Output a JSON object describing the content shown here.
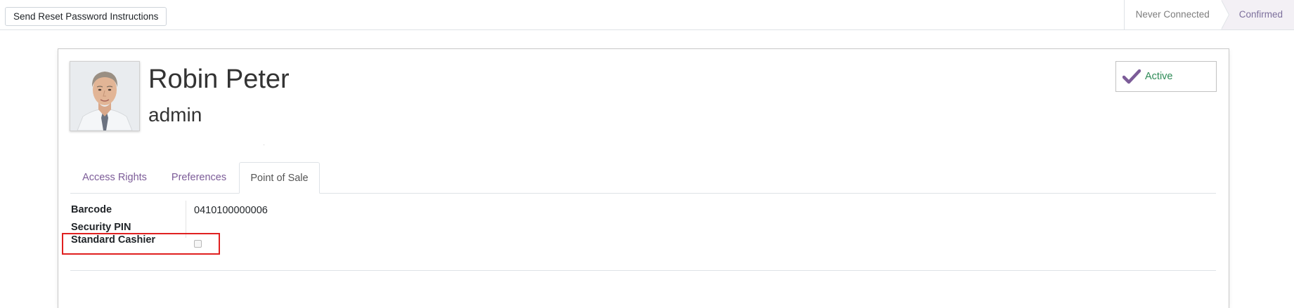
{
  "statusbar": {
    "reset_button_label": "Send Reset Password Instructions",
    "stages": [
      {
        "label": "Never Connected",
        "current": false
      },
      {
        "label": "Confirmed",
        "current": true
      }
    ]
  },
  "user": {
    "name": "Robin Peter",
    "login": "admin"
  },
  "active_toggle": {
    "label": "Active",
    "icon": "check-icon",
    "color": "#7c5c98"
  },
  "tabs": [
    {
      "label": "Access Rights",
      "active": false
    },
    {
      "label": "Preferences",
      "active": false
    },
    {
      "label": "Point of Sale",
      "active": true
    }
  ],
  "pos_fields": {
    "barcode_label": "Barcode",
    "barcode_value": "0410100000006",
    "security_pin_label": "Security PIN",
    "standard_cashier_label": "Standard Cashier",
    "standard_cashier_checked": false
  },
  "colors": {
    "accent": "#875a7b",
    "highlight": "#e02020",
    "active_text": "#2e8b57"
  }
}
